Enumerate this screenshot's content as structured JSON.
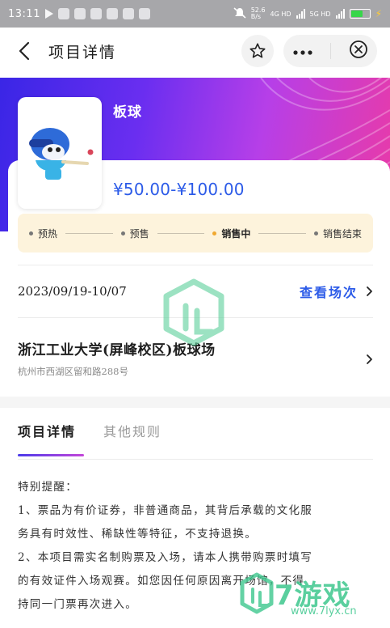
{
  "status_bar": {
    "time": "13:11",
    "network_speed": "52.6",
    "network_unit": "B/s",
    "net1": "4G HD",
    "net2": "5G HD",
    "battery": "65"
  },
  "nav": {
    "title": "项目详情"
  },
  "event": {
    "name": "板球",
    "price": "¥50.00-¥100.00"
  },
  "steps": [
    {
      "label": "预热"
    },
    {
      "label": "预售"
    },
    {
      "label": "销售中"
    },
    {
      "label": "销售结束"
    }
  ],
  "session": {
    "date": "2023/09/19-10/07",
    "link_label": "查看场次"
  },
  "venue": {
    "name": "浙江工业大学(屏峰校区)板球场",
    "address": "杭州市西湖区留和路288号"
  },
  "tabs": [
    {
      "label": "项目详情"
    },
    {
      "label": "其他规则"
    }
  ],
  "content": {
    "heading": "特别提醒：",
    "lines": [
      "1、票品为有价证券，非普通商品，其背后承载的文化服",
      "务具有时效性、稀缺性等特征，不支持退换。",
      "2、本项目需实名制购票及入场，请本人携带购票时填写",
      "的有效证件入场观赛。如您因任何原因离开场馆，不得",
      "持同一门票再次进入。"
    ]
  },
  "watermark": {
    "brand": "7游戏",
    "url": "www.7lyx.cn"
  }
}
